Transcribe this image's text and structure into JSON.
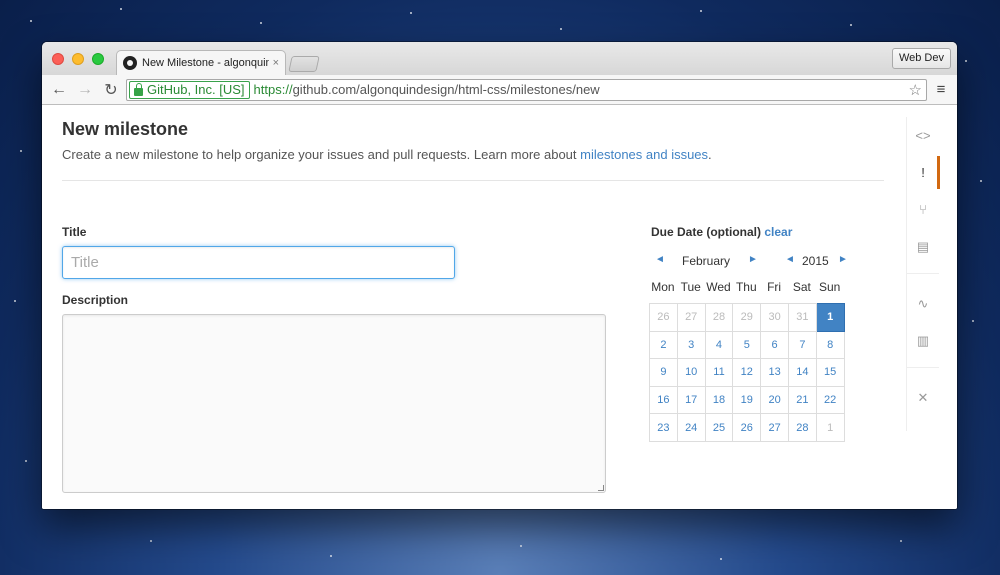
{
  "browser": {
    "tab_title": "New Milestone - algonquindesign",
    "tab_close": "×",
    "profile_button": "Web Dev",
    "nav_back": "←",
    "nav_forward": "→",
    "nav_reload": "↻",
    "ev_label": "GitHub, Inc. [US]",
    "url_scheme": "https://",
    "url_rest": "github.com/algonquindesign/html-css/milestones/new",
    "star": "☆",
    "menu": "≡"
  },
  "page": {
    "heading": "New milestone",
    "subtitle_text": "Create a new milestone to help organize your issues and pull requests. Learn more about ",
    "subtitle_link": "milestones and issues",
    "subtitle_end": ".",
    "title_label": "Title",
    "title_placeholder": "Title",
    "title_value": "",
    "description_label": "Description",
    "due_label": "Due Date (optional)",
    "due_clear": "clear"
  },
  "calendar": {
    "month": "February",
    "year": "2015",
    "prev": "◄",
    "next": "►",
    "weekdays": [
      "Mon",
      "Tue",
      "Wed",
      "Thu",
      "Fri",
      "Sat",
      "Sun"
    ],
    "weeks": [
      [
        "26",
        "27",
        "28",
        "29",
        "30",
        "31",
        "1"
      ],
      [
        "2",
        "3",
        "4",
        "5",
        "6",
        "7",
        "8"
      ],
      [
        "9",
        "10",
        "11",
        "12",
        "13",
        "14",
        "15"
      ],
      [
        "16",
        "17",
        "18",
        "19",
        "20",
        "21",
        "22"
      ],
      [
        "23",
        "24",
        "25",
        "26",
        "27",
        "28",
        "1"
      ]
    ],
    "selected": "1"
  },
  "rail": {
    "code": "<>",
    "issues": "!",
    "pulls": "⑂",
    "wiki": "▤",
    "pulse": "∿",
    "graphs": "▥",
    "settings": "✕"
  },
  "colors": {
    "link": "#4183c4",
    "accent_rail": "#d26911",
    "ev_green": "#2a8a34"
  }
}
